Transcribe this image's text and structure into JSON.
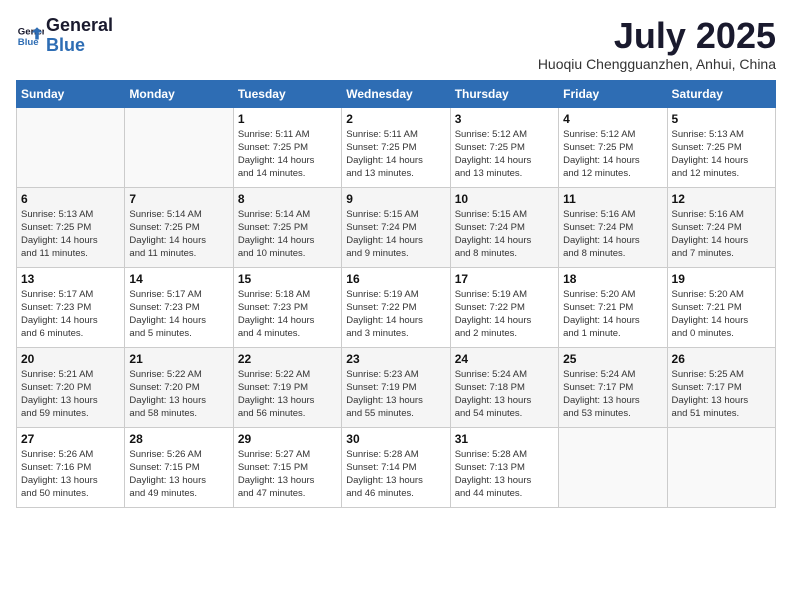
{
  "header": {
    "logo_line1": "General",
    "logo_line2": "Blue",
    "month": "July 2025",
    "location": "Huoqiu Chengguanzhen, Anhui, China"
  },
  "weekdays": [
    "Sunday",
    "Monday",
    "Tuesday",
    "Wednesday",
    "Thursday",
    "Friday",
    "Saturday"
  ],
  "weeks": [
    [
      {
        "day": "",
        "info": ""
      },
      {
        "day": "",
        "info": ""
      },
      {
        "day": "1",
        "info": "Sunrise: 5:11 AM\nSunset: 7:25 PM\nDaylight: 14 hours\nand 14 minutes."
      },
      {
        "day": "2",
        "info": "Sunrise: 5:11 AM\nSunset: 7:25 PM\nDaylight: 14 hours\nand 13 minutes."
      },
      {
        "day": "3",
        "info": "Sunrise: 5:12 AM\nSunset: 7:25 PM\nDaylight: 14 hours\nand 13 minutes."
      },
      {
        "day": "4",
        "info": "Sunrise: 5:12 AM\nSunset: 7:25 PM\nDaylight: 14 hours\nand 12 minutes."
      },
      {
        "day": "5",
        "info": "Sunrise: 5:13 AM\nSunset: 7:25 PM\nDaylight: 14 hours\nand 12 minutes."
      }
    ],
    [
      {
        "day": "6",
        "info": "Sunrise: 5:13 AM\nSunset: 7:25 PM\nDaylight: 14 hours\nand 11 minutes."
      },
      {
        "day": "7",
        "info": "Sunrise: 5:14 AM\nSunset: 7:25 PM\nDaylight: 14 hours\nand 11 minutes."
      },
      {
        "day": "8",
        "info": "Sunrise: 5:14 AM\nSunset: 7:25 PM\nDaylight: 14 hours\nand 10 minutes."
      },
      {
        "day": "9",
        "info": "Sunrise: 5:15 AM\nSunset: 7:24 PM\nDaylight: 14 hours\nand 9 minutes."
      },
      {
        "day": "10",
        "info": "Sunrise: 5:15 AM\nSunset: 7:24 PM\nDaylight: 14 hours\nand 8 minutes."
      },
      {
        "day": "11",
        "info": "Sunrise: 5:16 AM\nSunset: 7:24 PM\nDaylight: 14 hours\nand 8 minutes."
      },
      {
        "day": "12",
        "info": "Sunrise: 5:16 AM\nSunset: 7:24 PM\nDaylight: 14 hours\nand 7 minutes."
      }
    ],
    [
      {
        "day": "13",
        "info": "Sunrise: 5:17 AM\nSunset: 7:23 PM\nDaylight: 14 hours\nand 6 minutes."
      },
      {
        "day": "14",
        "info": "Sunrise: 5:17 AM\nSunset: 7:23 PM\nDaylight: 14 hours\nand 5 minutes."
      },
      {
        "day": "15",
        "info": "Sunrise: 5:18 AM\nSunset: 7:23 PM\nDaylight: 14 hours\nand 4 minutes."
      },
      {
        "day": "16",
        "info": "Sunrise: 5:19 AM\nSunset: 7:22 PM\nDaylight: 14 hours\nand 3 minutes."
      },
      {
        "day": "17",
        "info": "Sunrise: 5:19 AM\nSunset: 7:22 PM\nDaylight: 14 hours\nand 2 minutes."
      },
      {
        "day": "18",
        "info": "Sunrise: 5:20 AM\nSunset: 7:21 PM\nDaylight: 14 hours\nand 1 minute."
      },
      {
        "day": "19",
        "info": "Sunrise: 5:20 AM\nSunset: 7:21 PM\nDaylight: 14 hours\nand 0 minutes."
      }
    ],
    [
      {
        "day": "20",
        "info": "Sunrise: 5:21 AM\nSunset: 7:20 PM\nDaylight: 13 hours\nand 59 minutes."
      },
      {
        "day": "21",
        "info": "Sunrise: 5:22 AM\nSunset: 7:20 PM\nDaylight: 13 hours\nand 58 minutes."
      },
      {
        "day": "22",
        "info": "Sunrise: 5:22 AM\nSunset: 7:19 PM\nDaylight: 13 hours\nand 56 minutes."
      },
      {
        "day": "23",
        "info": "Sunrise: 5:23 AM\nSunset: 7:19 PM\nDaylight: 13 hours\nand 55 minutes."
      },
      {
        "day": "24",
        "info": "Sunrise: 5:24 AM\nSunset: 7:18 PM\nDaylight: 13 hours\nand 54 minutes."
      },
      {
        "day": "25",
        "info": "Sunrise: 5:24 AM\nSunset: 7:17 PM\nDaylight: 13 hours\nand 53 minutes."
      },
      {
        "day": "26",
        "info": "Sunrise: 5:25 AM\nSunset: 7:17 PM\nDaylight: 13 hours\nand 51 minutes."
      }
    ],
    [
      {
        "day": "27",
        "info": "Sunrise: 5:26 AM\nSunset: 7:16 PM\nDaylight: 13 hours\nand 50 minutes."
      },
      {
        "day": "28",
        "info": "Sunrise: 5:26 AM\nSunset: 7:15 PM\nDaylight: 13 hours\nand 49 minutes."
      },
      {
        "day": "29",
        "info": "Sunrise: 5:27 AM\nSunset: 7:15 PM\nDaylight: 13 hours\nand 47 minutes."
      },
      {
        "day": "30",
        "info": "Sunrise: 5:28 AM\nSunset: 7:14 PM\nDaylight: 13 hours\nand 46 minutes."
      },
      {
        "day": "31",
        "info": "Sunrise: 5:28 AM\nSunset: 7:13 PM\nDaylight: 13 hours\nand 44 minutes."
      },
      {
        "day": "",
        "info": ""
      },
      {
        "day": "",
        "info": ""
      }
    ]
  ]
}
